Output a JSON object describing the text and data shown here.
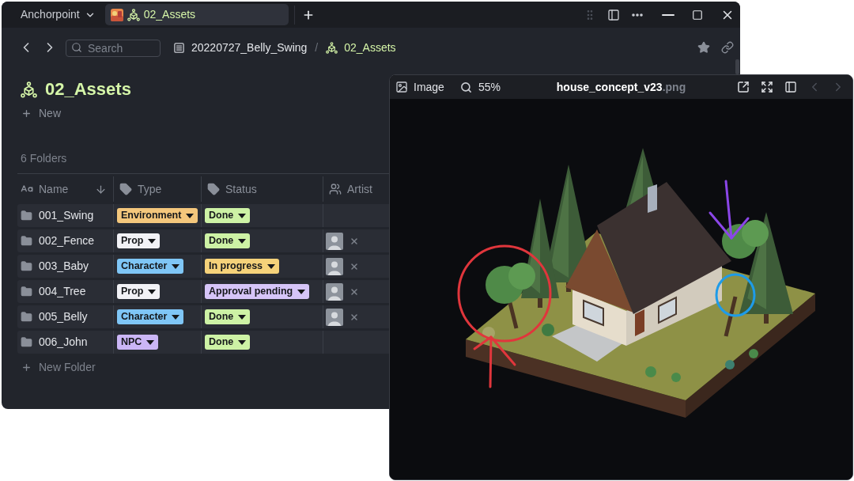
{
  "window": {
    "app_menu": "Anchorpoint",
    "tabs": [
      {
        "label": "02_Assets",
        "selected": true
      }
    ]
  },
  "toolbar": {
    "search": {
      "placeholder": "Search"
    },
    "breadcrumbs": [
      {
        "label": "20220727_Belly_Swing",
        "kind": "project"
      },
      {
        "label": "02_Assets",
        "kind": "folder"
      }
    ],
    "separator": "/"
  },
  "page": {
    "title": "02_Assets",
    "new_label": "New",
    "count": "6 Folders"
  },
  "table": {
    "columns": [
      {
        "label": "Name",
        "kind": "name",
        "sorted": true
      },
      {
        "label": "Type",
        "kind": "tag",
        "sorted": false
      },
      {
        "label": "Status",
        "kind": "tag",
        "sorted": false
      },
      {
        "label": "Artist",
        "kind": "people",
        "sorted": false
      }
    ],
    "rows": [
      {
        "name": "001_Swing",
        "type": {
          "label": "Environment",
          "color": "#f4c77c"
        },
        "status": {
          "label": "Done",
          "color": "#cdf2a5"
        },
        "artist_assigned": false
      },
      {
        "name": "002_Fence",
        "type": {
          "label": "Prop",
          "color": "#f2f2f6"
        },
        "status": {
          "label": "Done",
          "color": "#cdf2a5"
        },
        "artist_assigned": true
      },
      {
        "name": "003_Baby",
        "type": {
          "label": "Character",
          "color": "#7fc6f6"
        },
        "status": {
          "label": "In progress",
          "color": "#f5d27a"
        },
        "artist_assigned": true
      },
      {
        "name": "004_Tree",
        "type": {
          "label": "Prop",
          "color": "#f2f2f6"
        },
        "status": {
          "label": "Approval pending",
          "color": "#d6c5f8"
        },
        "artist_assigned": true
      },
      {
        "name": "005_Belly",
        "type": {
          "label": "Character",
          "color": "#7fc6f6"
        },
        "status": {
          "label": "Done",
          "color": "#cdf2a5"
        },
        "artist_assigned": true
      },
      {
        "name": "006_John",
        "type": {
          "label": "NPC",
          "color": "#cbb6f6"
        },
        "status": {
          "label": "Done",
          "color": "#cdf2a5"
        },
        "artist_assigned": false
      }
    ],
    "add_label": "New Folder"
  },
  "viewer": {
    "mode": "Image",
    "zoom": "55%",
    "file_name": "house_concept_v23",
    "file_extension": ".png",
    "prev_disabled": true,
    "next_disabled": true
  }
}
